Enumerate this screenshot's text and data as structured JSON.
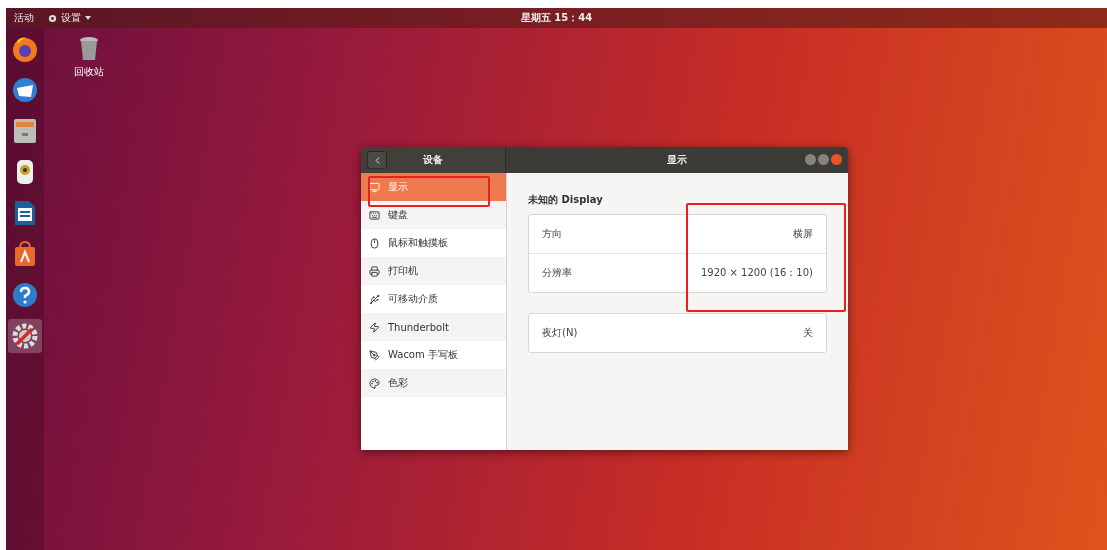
{
  "top_bar": {
    "activities": "活动",
    "app_menu": "设置",
    "clock": "星期五 15：44"
  },
  "dock": [
    {
      "kind": "browser",
      "active": false
    },
    {
      "kind": "mail",
      "active": false
    },
    {
      "kind": "files",
      "active": false
    },
    {
      "kind": "music",
      "active": false
    },
    {
      "kind": "document",
      "active": false
    },
    {
      "kind": "store",
      "active": false
    },
    {
      "kind": "help",
      "active": false
    },
    {
      "kind": "settings",
      "active": true
    }
  ],
  "desktop_icons": [
    {
      "label": "回收站"
    }
  ],
  "window": {
    "sidebar_title": "设备",
    "title": "显示",
    "sidebar": [
      {
        "kind": "display",
        "label": "显示",
        "selected": true
      },
      {
        "kind": "keyboard",
        "label": "键盘",
        "selected": false
      },
      {
        "kind": "mouse",
        "label": "鼠标和触摸板",
        "selected": false
      },
      {
        "kind": "printer",
        "label": "打印机",
        "selected": false
      },
      {
        "kind": "removable",
        "label": "可移动介质",
        "selected": false
      },
      {
        "kind": "thunderbolt",
        "label": "Thunderbolt",
        "selected": false
      },
      {
        "kind": "wacom",
        "label": "Wacom 手写板",
        "selected": false
      },
      {
        "kind": "color",
        "label": "色彩",
        "selected": false
      }
    ],
    "display_name": "未知的 Display",
    "display_settings": [
      {
        "label": "方向",
        "value": "横屏"
      },
      {
        "label": "分辨率",
        "value": "1920 × 1200 (16：10)"
      }
    ],
    "night_light": {
      "label": "夜灯(N)",
      "value": "关"
    }
  }
}
